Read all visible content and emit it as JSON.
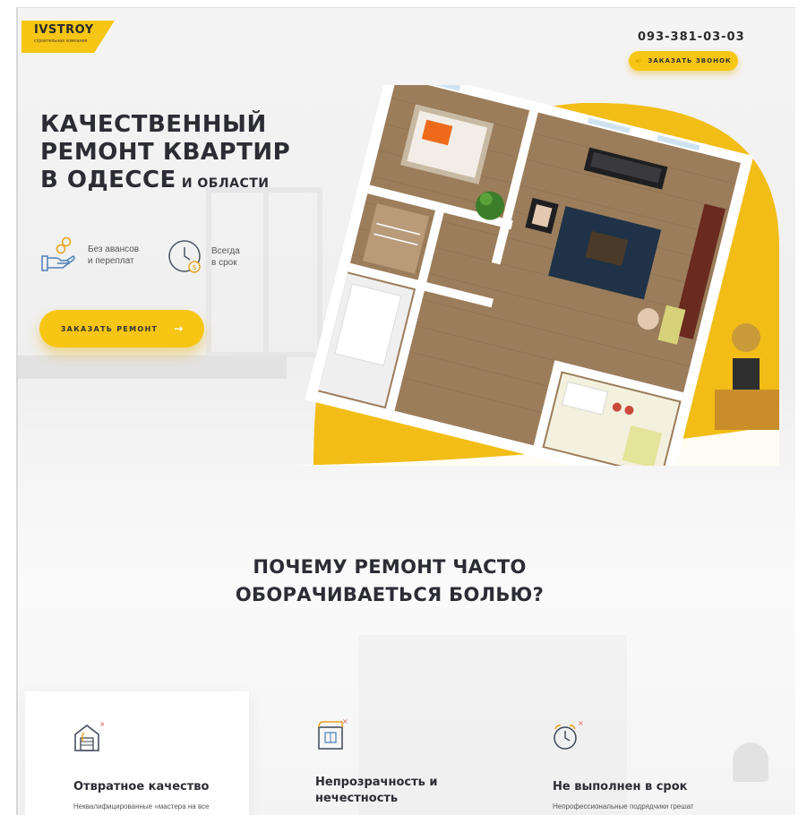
{
  "header": {
    "logo_name": "IVSTROY",
    "logo_sub": "строительная компания",
    "phone": "093-381-03-03",
    "callback_label": "ЗАКАЗАТЬ ЗВОНОК"
  },
  "hero": {
    "title_line1": "КАЧЕСТВЕННЫЙ",
    "title_line2": "РЕМОНТ КВАРТИР",
    "title_line3": "В ОДЕССЕ",
    "title_suffix": "И ОБЛАСТИ",
    "features": [
      {
        "line1": "Без авансов",
        "line2": "и переплат",
        "icon": "hand-coins-icon"
      },
      {
        "line1": "Всегда",
        "line2": "в срок",
        "icon": "clock-dollar-icon"
      }
    ],
    "order_button": "ЗАКАЗАТЬ РЕМОНТ",
    "order_arrow": "→"
  },
  "why": {
    "title_line1": "ПОЧЕМУ РЕМОНТ ЧАСТО",
    "title_line2": "ОБОРАЧИВАЕТЬСЯ БОЛЬЮ?",
    "cards": [
      {
        "title": "Отвратное качество",
        "text": "Неквалифицированные «мастера на все",
        "icon": "garage-house-icon"
      },
      {
        "title_line1": "Непрозрачность и",
        "title_line2": "нечестность",
        "icon": "blueprint-icon"
      },
      {
        "title": "Не выполнен в срок",
        "text": "Непрофессиональные подрядчики грешат",
        "icon": "alarm-clock-icon"
      }
    ]
  },
  "colors": {
    "accent": "#f7c614",
    "text_dark": "#2c2c34",
    "icon_red": "#e05a4e"
  }
}
